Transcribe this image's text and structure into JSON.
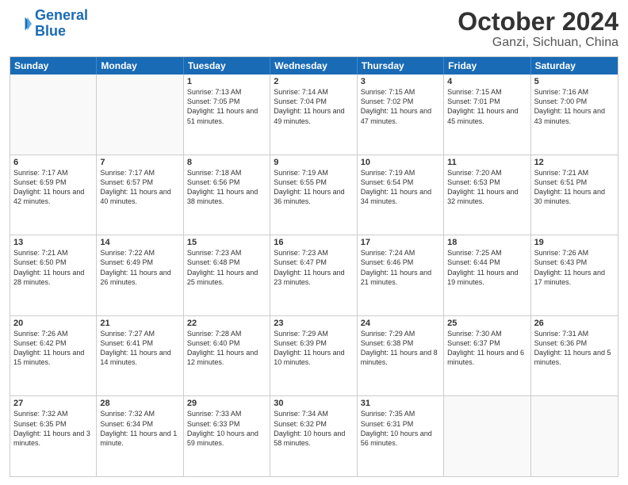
{
  "logo": {
    "line1": "General",
    "line2": "Blue"
  },
  "title": "October 2024",
  "location": "Ganzi, Sichuan, China",
  "days_of_week": [
    "Sunday",
    "Monday",
    "Tuesday",
    "Wednesday",
    "Thursday",
    "Friday",
    "Saturday"
  ],
  "weeks": [
    [
      {
        "day": "",
        "text": "",
        "empty": true
      },
      {
        "day": "",
        "text": "",
        "empty": true
      },
      {
        "day": "1",
        "text": "Sunrise: 7:13 AM\nSunset: 7:05 PM\nDaylight: 11 hours and 51 minutes."
      },
      {
        "day": "2",
        "text": "Sunrise: 7:14 AM\nSunset: 7:04 PM\nDaylight: 11 hours and 49 minutes."
      },
      {
        "day": "3",
        "text": "Sunrise: 7:15 AM\nSunset: 7:02 PM\nDaylight: 11 hours and 47 minutes."
      },
      {
        "day": "4",
        "text": "Sunrise: 7:15 AM\nSunset: 7:01 PM\nDaylight: 11 hours and 45 minutes."
      },
      {
        "day": "5",
        "text": "Sunrise: 7:16 AM\nSunset: 7:00 PM\nDaylight: 11 hours and 43 minutes."
      }
    ],
    [
      {
        "day": "6",
        "text": "Sunrise: 7:17 AM\nSunset: 6:59 PM\nDaylight: 11 hours and 42 minutes."
      },
      {
        "day": "7",
        "text": "Sunrise: 7:17 AM\nSunset: 6:57 PM\nDaylight: 11 hours and 40 minutes."
      },
      {
        "day": "8",
        "text": "Sunrise: 7:18 AM\nSunset: 6:56 PM\nDaylight: 11 hours and 38 minutes."
      },
      {
        "day": "9",
        "text": "Sunrise: 7:19 AM\nSunset: 6:55 PM\nDaylight: 11 hours and 36 minutes."
      },
      {
        "day": "10",
        "text": "Sunrise: 7:19 AM\nSunset: 6:54 PM\nDaylight: 11 hours and 34 minutes."
      },
      {
        "day": "11",
        "text": "Sunrise: 7:20 AM\nSunset: 6:53 PM\nDaylight: 11 hours and 32 minutes."
      },
      {
        "day": "12",
        "text": "Sunrise: 7:21 AM\nSunset: 6:51 PM\nDaylight: 11 hours and 30 minutes."
      }
    ],
    [
      {
        "day": "13",
        "text": "Sunrise: 7:21 AM\nSunset: 6:50 PM\nDaylight: 11 hours and 28 minutes."
      },
      {
        "day": "14",
        "text": "Sunrise: 7:22 AM\nSunset: 6:49 PM\nDaylight: 11 hours and 26 minutes."
      },
      {
        "day": "15",
        "text": "Sunrise: 7:23 AM\nSunset: 6:48 PM\nDaylight: 11 hours and 25 minutes."
      },
      {
        "day": "16",
        "text": "Sunrise: 7:23 AM\nSunset: 6:47 PM\nDaylight: 11 hours and 23 minutes."
      },
      {
        "day": "17",
        "text": "Sunrise: 7:24 AM\nSunset: 6:46 PM\nDaylight: 11 hours and 21 minutes."
      },
      {
        "day": "18",
        "text": "Sunrise: 7:25 AM\nSunset: 6:44 PM\nDaylight: 11 hours and 19 minutes."
      },
      {
        "day": "19",
        "text": "Sunrise: 7:26 AM\nSunset: 6:43 PM\nDaylight: 11 hours and 17 minutes."
      }
    ],
    [
      {
        "day": "20",
        "text": "Sunrise: 7:26 AM\nSunset: 6:42 PM\nDaylight: 11 hours and 15 minutes."
      },
      {
        "day": "21",
        "text": "Sunrise: 7:27 AM\nSunset: 6:41 PM\nDaylight: 11 hours and 14 minutes."
      },
      {
        "day": "22",
        "text": "Sunrise: 7:28 AM\nSunset: 6:40 PM\nDaylight: 11 hours and 12 minutes."
      },
      {
        "day": "23",
        "text": "Sunrise: 7:29 AM\nSunset: 6:39 PM\nDaylight: 11 hours and 10 minutes."
      },
      {
        "day": "24",
        "text": "Sunrise: 7:29 AM\nSunset: 6:38 PM\nDaylight: 11 hours and 8 minutes."
      },
      {
        "day": "25",
        "text": "Sunrise: 7:30 AM\nSunset: 6:37 PM\nDaylight: 11 hours and 6 minutes."
      },
      {
        "day": "26",
        "text": "Sunrise: 7:31 AM\nSunset: 6:36 PM\nDaylight: 11 hours and 5 minutes."
      }
    ],
    [
      {
        "day": "27",
        "text": "Sunrise: 7:32 AM\nSunset: 6:35 PM\nDaylight: 11 hours and 3 minutes."
      },
      {
        "day": "28",
        "text": "Sunrise: 7:32 AM\nSunset: 6:34 PM\nDaylight: 11 hours and 1 minute."
      },
      {
        "day": "29",
        "text": "Sunrise: 7:33 AM\nSunset: 6:33 PM\nDaylight: 10 hours and 59 minutes."
      },
      {
        "day": "30",
        "text": "Sunrise: 7:34 AM\nSunset: 6:32 PM\nDaylight: 10 hours and 58 minutes."
      },
      {
        "day": "31",
        "text": "Sunrise: 7:35 AM\nSunset: 6:31 PM\nDaylight: 10 hours and 56 minutes."
      },
      {
        "day": "",
        "text": "",
        "empty": true
      },
      {
        "day": "",
        "text": "",
        "empty": true
      }
    ]
  ]
}
